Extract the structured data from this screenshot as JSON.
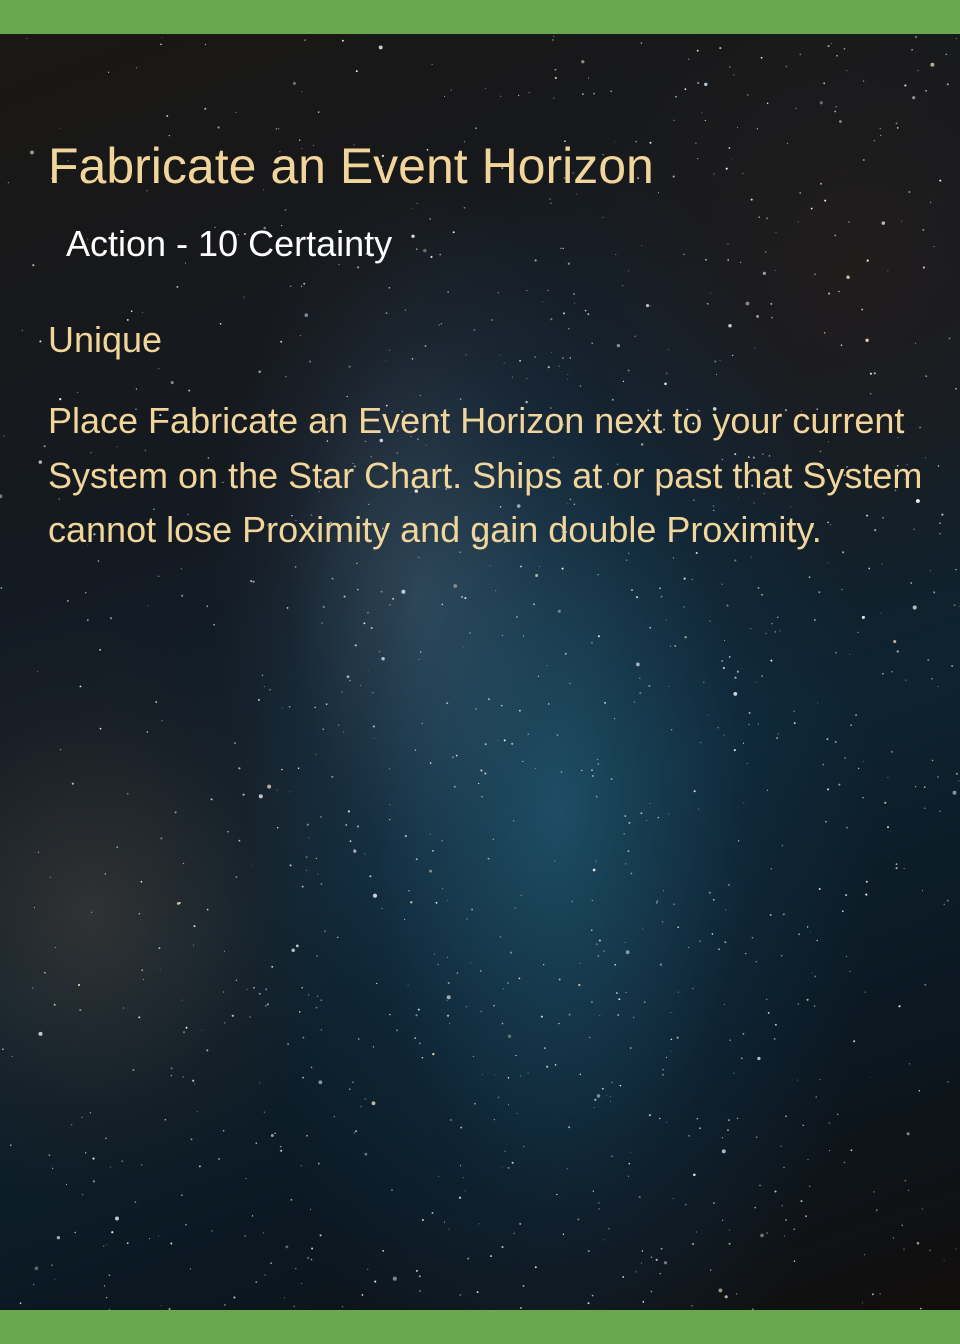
{
  "card": {
    "title": "Fabricate an Event Horizon",
    "subtitle": "Action - 10 Certainty",
    "keyword": "Unique",
    "body": "Place Fabricate an Event Horizon next to your current System on the Star Chart. Ships at or past that System cannot lose Proximity and gain double Proximity."
  },
  "colors": {
    "border": "#6aa84f",
    "title_text": "#f1d59a",
    "subtitle_text": "#ffffff",
    "body_text": "#f1d59a"
  }
}
